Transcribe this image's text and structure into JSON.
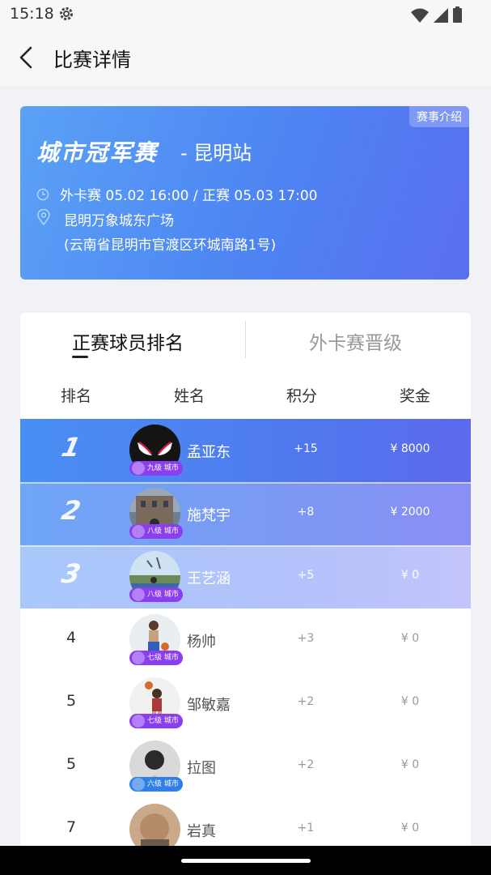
{
  "status_bar": {
    "time": "15:18"
  },
  "header": {
    "title": "比赛详情"
  },
  "banner": {
    "tag": "赛事介绍",
    "logo_text": "城市冠军赛",
    "station": "- 昆明站",
    "schedule": "外卡赛 05.02 16:00 / 正赛 05.03 17:00",
    "venue": "昆明万象城东广场",
    "address": "(云南省昆明市官渡区环城南路1号)",
    "colors": {
      "start": "#5aa2f6",
      "end": "#5a6ef0"
    }
  },
  "tabs": [
    {
      "label": "正赛球员排名",
      "active": true
    },
    {
      "label": "外卡赛晋级",
      "active": false
    }
  ],
  "columns": [
    "排名",
    "姓名",
    "积分",
    "奖金"
  ],
  "players": [
    {
      "rank": "1",
      "name": "孟亚东",
      "points": "+15",
      "prize": "¥ 8000",
      "level": "九级",
      "badge_suffix": "城市"
    },
    {
      "rank": "2",
      "name": "施梵宇",
      "points": "+8",
      "prize": "¥ 2000",
      "level": "八级",
      "badge_suffix": "城市"
    },
    {
      "rank": "3",
      "name": "王艺涵",
      "points": "+5",
      "prize": "¥ 0",
      "level": "八级",
      "badge_suffix": "城市"
    },
    {
      "rank": "4",
      "name": "杨帅",
      "points": "+3",
      "prize": "¥ 0",
      "level": "七级",
      "badge_suffix": "城市"
    },
    {
      "rank": "5",
      "name": "邹敏嘉",
      "points": "+2",
      "prize": "¥ 0",
      "level": "七级",
      "badge_suffix": "城市"
    },
    {
      "rank": "5",
      "name": "拉图",
      "points": "+2",
      "prize": "¥ 0",
      "level": "六级",
      "badge_suffix": "城市"
    },
    {
      "rank": "7",
      "name": "岩真",
      "points": "+1",
      "prize": "¥ 0",
      "level": "",
      "badge_suffix": ""
    }
  ]
}
